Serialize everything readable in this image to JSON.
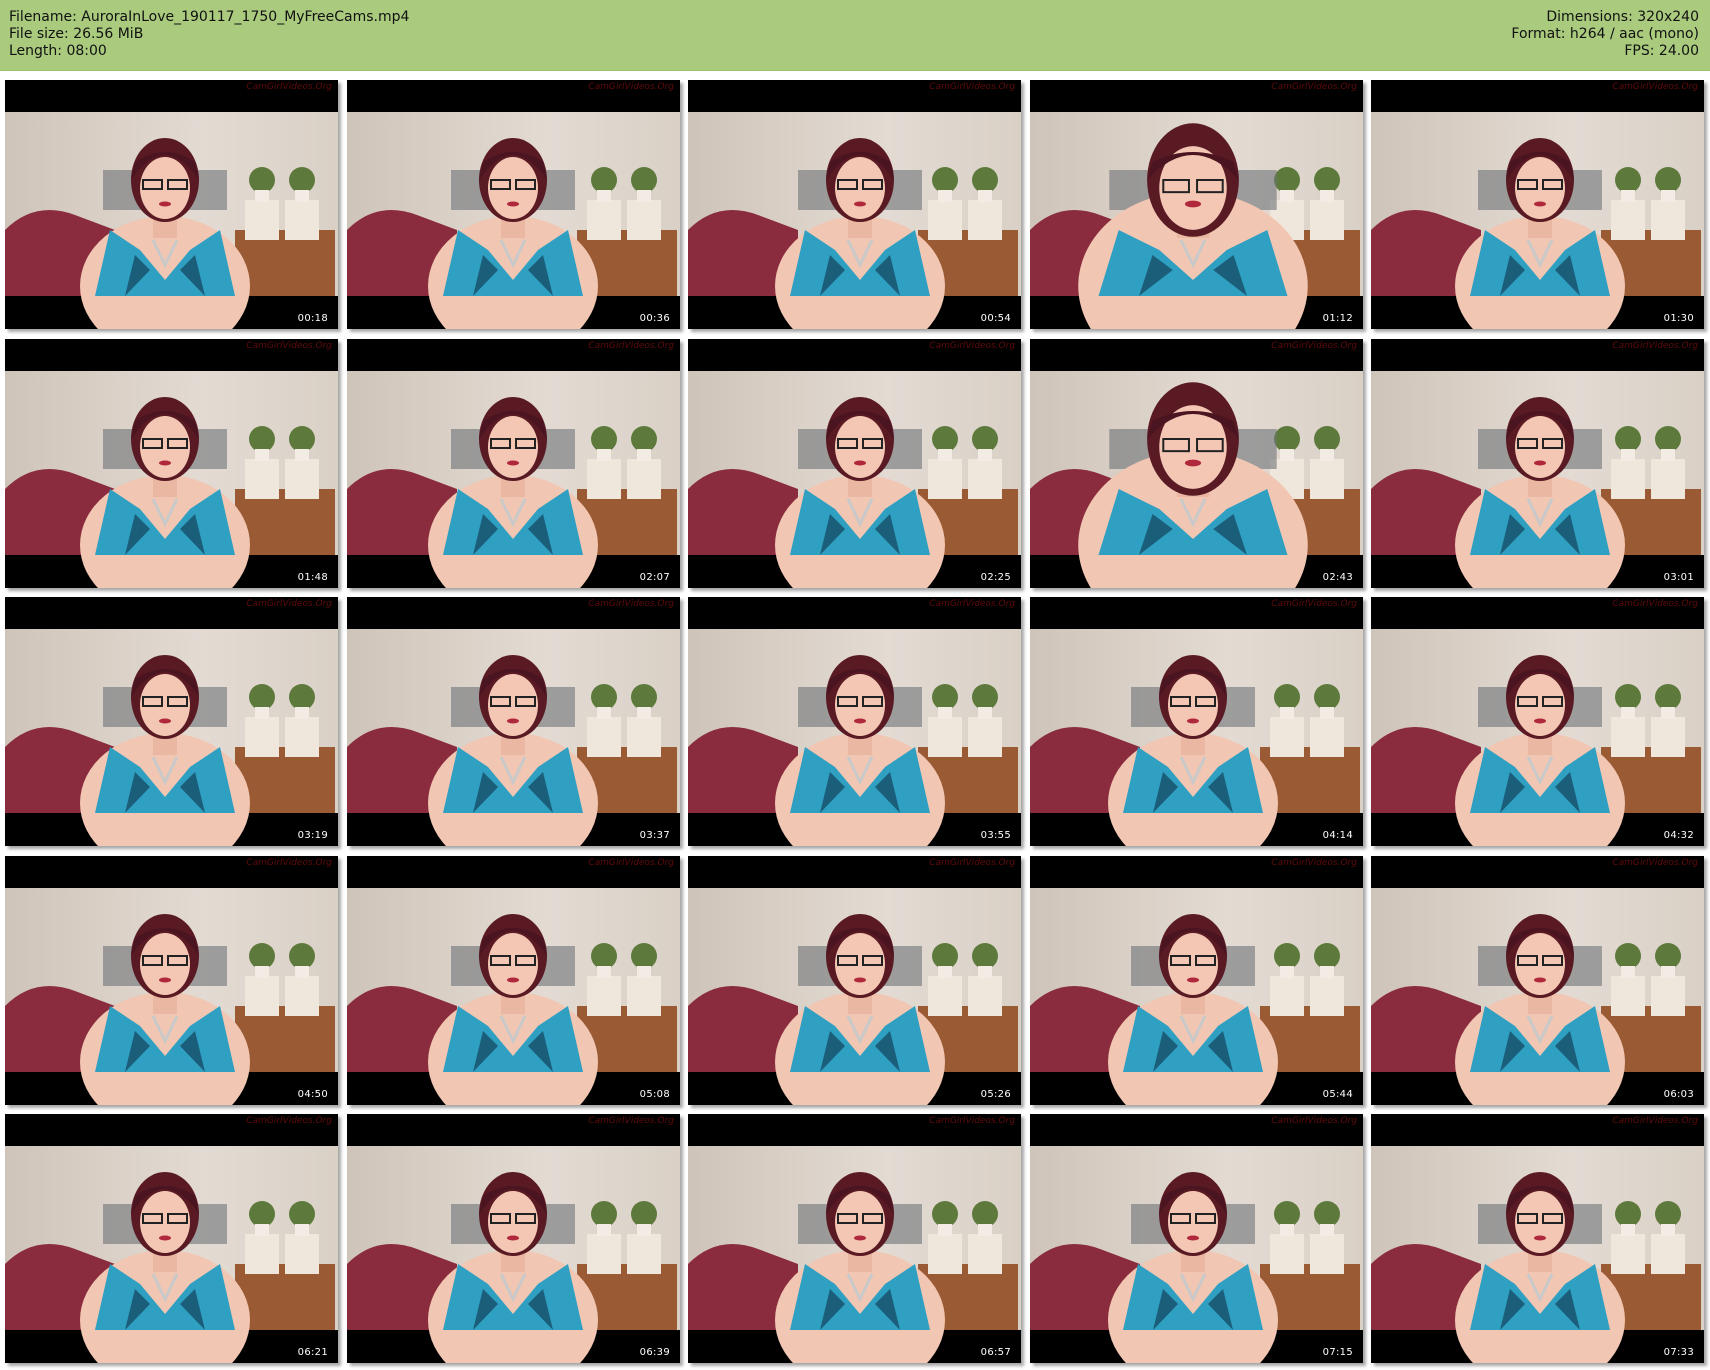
{
  "header": {
    "left": {
      "filename": "Filename: AuroraInLove_190117_1750_MyFreeCams.mp4",
      "filesize": "File size: 26.56 MiB",
      "length": "Length: 08:00"
    },
    "right": {
      "dimensions": "Dimensions: 320x240",
      "format": "Format: h264 / aac (mono)",
      "fps": "FPS: 24.00"
    },
    "background_color": "#aacb7e"
  },
  "watermark": "CamGirlVideos.Org",
  "thumbnails": [
    {
      "time": "00:18"
    },
    {
      "time": "00:36"
    },
    {
      "time": "00:54"
    },
    {
      "time": "01:12"
    },
    {
      "time": "01:30"
    },
    {
      "time": "01:48"
    },
    {
      "time": "02:07"
    },
    {
      "time": "02:25"
    },
    {
      "time": "02:43"
    },
    {
      "time": "03:01"
    },
    {
      "time": "03:19"
    },
    {
      "time": "03:37"
    },
    {
      "time": "03:55"
    },
    {
      "time": "04:14"
    },
    {
      "time": "04:32"
    },
    {
      "time": "04:50"
    },
    {
      "time": "05:08"
    },
    {
      "time": "05:26"
    },
    {
      "time": "05:44"
    },
    {
      "time": "06:03"
    },
    {
      "time": "06:21"
    },
    {
      "time": "06:39"
    },
    {
      "time": "06:57"
    },
    {
      "time": "07:15"
    },
    {
      "time": "07:33"
    }
  ]
}
